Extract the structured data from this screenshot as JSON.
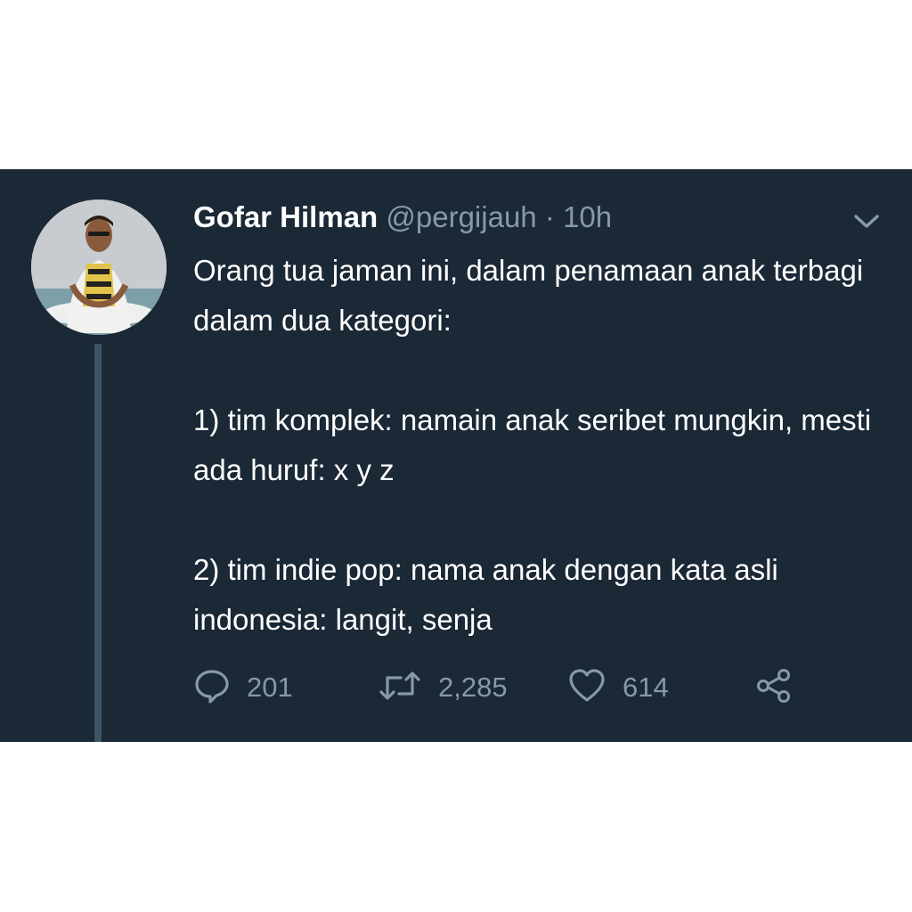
{
  "tweet": {
    "author": {
      "display_name": "Gofar Hilman",
      "handle": "@pergijauh",
      "separator": "·",
      "time": "10h"
    },
    "text_paragraphs": [
      "Orang tua jaman ini, dalam penamaan anak terbagi dalam dua kategori:",
      "1) tim komplek: namain anak seribet mungkin, mesti ada huruf: x y z",
      "2) tim indie pop: nama anak dengan kata asli indonesia: langit, senja"
    ],
    "actions": {
      "reply_count": "201",
      "retweet_count": "2,285",
      "like_count": "614"
    },
    "icons": {
      "reply": "reply-icon",
      "retweet": "retweet-icon",
      "like": "heart-icon",
      "share": "share-icon",
      "menu": "chevron-down-icon"
    }
  },
  "colors": {
    "background": "#1b2836",
    "text_primary": "#ffffff",
    "text_secondary": "#8899a6",
    "thread_line": "#3d5466"
  }
}
